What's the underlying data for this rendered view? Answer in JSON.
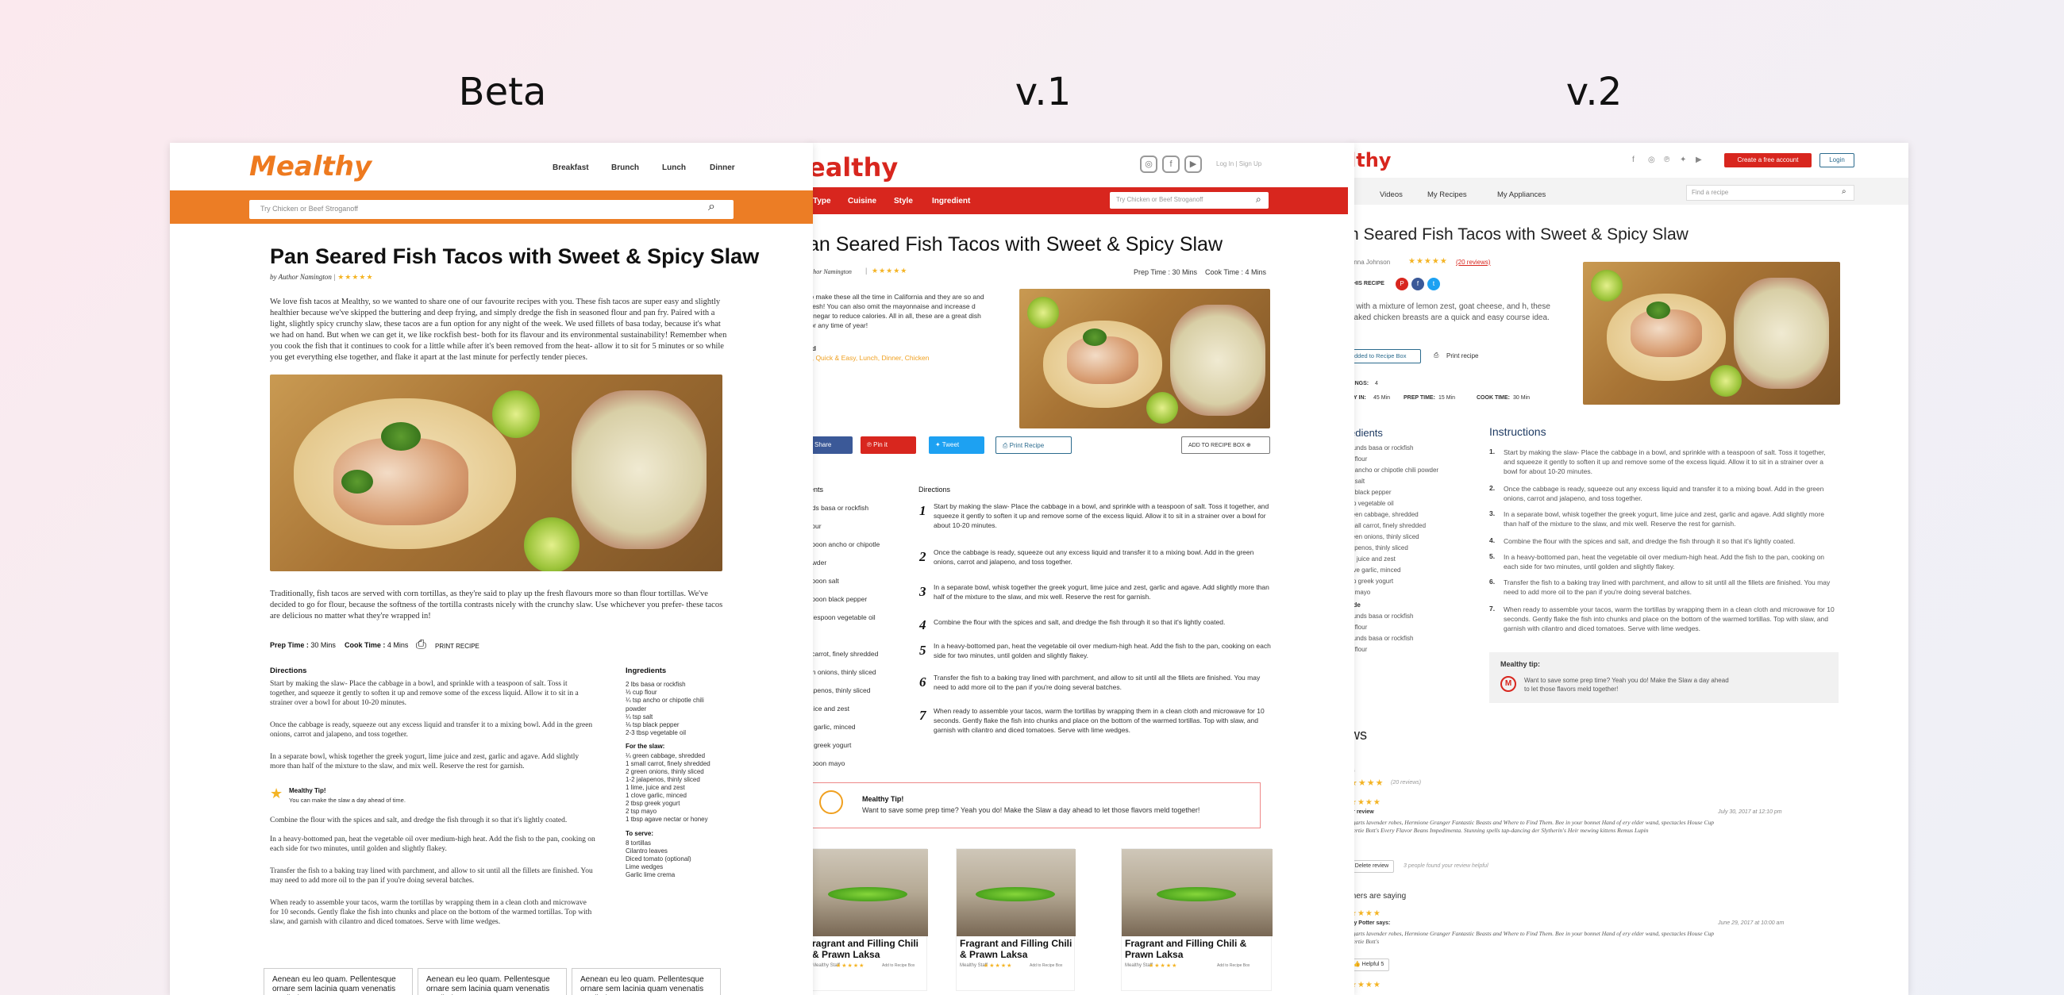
{
  "headings": {
    "beta": "Beta",
    "v1": "v.1",
    "v2": "v.2"
  },
  "recipe": {
    "title": "Pan Seared Fish Tacos with Sweet & Spicy Slaw",
    "v1_title": "an Seared Fish Tacos with Sweet & Spicy Slaw",
    "v2_title": "n Seared Fish Tacos with Sweet & Spicy Slaw"
  },
  "beta": {
    "logo": "Mealthy",
    "nav": [
      "Breakfast",
      "Brunch",
      "Lunch",
      "Dinner"
    ],
    "search_placeholder": "Try Chicken or Beef Stroganoff",
    "byline": "by Author Namington",
    "stars": "★★★★★",
    "intro": "We love fish tacos at Mealthy, so we wanted to share one of our favourite recipes with you. These fish tacos are super easy and slightly healthier because we've skipped the buttering and deep frying, and simply dredge the fish in seasoned flour and pan fry. Paired with a light, slightly spicy crunchy slaw, these tacos are a fun option for any night of the week. We used fillets of basa today, because it's what we had on hand. But when we can get it, we like rockfish best- both for its flavour and its environmental sustainability! Remember when you cook the fish that it continues to cook for a little while after it's been removed from the heat- allow it to sit for 5 minutes or so while you get everything else together, and flake it apart at the last minute for perfectly tender pieces.",
    "intro2": "Traditionally, fish tacos are served with corn tortillas, as they're said to play up the fresh flavours more so than flour tortillas. We've decided to go for flour, because the softness of the tortilla contrasts nicely with the crunchy slaw. Use whichever you prefer- these tacos are delicious no matter what they're wrapped in!",
    "prep_label": "Prep Time :",
    "prep_value": "30 Mins",
    "cook_label": "Cook Time :",
    "cook_value": "4 Mins",
    "print": "PRINT RECIPE",
    "directions_label": "Directions",
    "directions": [
      "Start by making the slaw- Place the cabbage in a bowl, and sprinkle with a teaspoon of salt. Toss it together, and squeeze it gently to soften it up and remove some of the excess liquid. Allow it to sit in a strainer over a bowl for about 10-20 minutes.",
      "Once the cabbage is ready, squeeze out any excess liquid and transfer it to a mixing bowl. Add in the green onions, carrot and jalapeno, and toss together.",
      "In a separate bowl, whisk together the greek yogurt, lime juice and zest, garlic and agave. Add slightly more than half of the mixture to the slaw, and mix well. Reserve the rest for garnish.",
      "Combine the flour with the spices and salt, and dredge the fish through it so that it's lightly coated.",
      "In a heavy-bottomed pan, heat the vegetable oil over medium-high heat. Add the fish to the pan, cooking on each side for two minutes, until golden and slightly flakey.",
      "Transfer the fish to a baking tray lined with parchment, and allow to sit until all the fillets are finished. You may need to add more oil to the pan if you're doing several batches.",
      "When ready to assemble your tacos, warm the tortillas by wrapping them in a clean cloth and microwave for 10 seconds. Gently flake the fish into chunks and place on the bottom of the warmed tortillas. Top with slaw, and garnish with cilantro and diced tomatoes. Serve with lime wedges."
    ],
    "tip_title": "Mealthy Tip!",
    "tip_text": "You can make the slaw a day ahead of time.",
    "ingredients_label": "Ingredients",
    "ingredients": [
      "2 lbs basa or rockfish",
      "⅓ cup flour",
      "¼ tsp ancho or chipotle chili powder",
      "¼ tsp salt",
      "⅛ tsp black pepper",
      "2-3 tbsp vegetable oil"
    ],
    "slaw_label": "For the slaw:",
    "slaw": [
      "¼ green cabbage, shredded",
      "1 small carrot, finely shredded",
      "2 green onions, thinly sliced",
      "1-2 jalapenos, thinly sliced",
      "1 lime, juice and zest",
      "1 clove garlic, minced",
      "2 tbsp greek yogurt",
      "2 tsp mayo",
      "1 tbsp agave nectar or honey"
    ],
    "serve_label": "To serve:",
    "serve": [
      "8 tortillas",
      "Cilantro leaves",
      "Diced tomato (optional)",
      "Lime wedges",
      "Garlic lime crema"
    ],
    "cards": [
      "Aenean eu leo quam. Pellentesque ornare sem lacinia quam venenatis vestibulum",
      "Aenean eu leo quam. Pellentesque ornare sem lacinia quam venenatis vestibulum",
      "Aenean eu leo quam. Pellentesque ornare sem lacinia quam venenatis vestibulum"
    ]
  },
  "v1": {
    "logo": "ealthy",
    "nav": [
      "Type",
      "Cuisine",
      "Style",
      "Ingredient"
    ],
    "search_placeholder": "Try Chicken or Beef Stroganoff",
    "login": "Log In | Sign Up",
    "byline": "uthor Namington",
    "stars": "★★★★★",
    "prep": "Prep Time : 30 Mins",
    "cook": "Cook Time : 4 Mins",
    "intro": "to make these all the time in California and they are so and fresh! You can also omit the mayonnaise and increase d vinegar to reduce calories. All in all, these are a great dish for any time of year!",
    "tags_label": "ed",
    "tags": "n, Quick & Easy, Lunch, Dinner, Chicken",
    "share": "Share",
    "pin": "Pin it",
    "tweet": "Tweet",
    "print": "Print Recipe",
    "add_box": "ADD TO RECIPE BOX",
    "ingredients_label": "ients",
    "ingredients": [
      "nds basa or rockfish",
      "flour",
      "spoon ancho or chipotle",
      "owder",
      "spoon salt",
      "spoon black pepper",
      "blespoon vegetable oil",
      "",
      "l carrot, finely shredded",
      "en onions, thinly sliced",
      "lapenos, thinly sliced",
      "juice and zest",
      "e garlic, minced",
      "p greek yogurt",
      "spoon mayo"
    ],
    "directions_label": "Directions",
    "tip_title": "Mealthy Tip!",
    "tip_text": "Want to save some prep time? Yeah you do! Make the Slaw a day ahead to let those flavors meld together!",
    "cards": [
      {
        "title": "ragrant and Filling Chili & Prawn Laksa",
        "by": "Mealthy Staff",
        "stars": "★★★★★",
        "detail": "Add to Recipe Box"
      },
      {
        "title": "Fragrant and Filling Chili & Prawn Laksa",
        "by": "Mealthy Staff",
        "stars": "★★★★★",
        "detail": "Add to Recipe Box"
      },
      {
        "title": "Fragrant and Filling Chili & Prawn Laksa",
        "by": "Mealthy Staff",
        "stars": "★★★★★",
        "detail": "Add to Recipe Box"
      }
    ]
  },
  "v2": {
    "logo": "lthy",
    "create_account": "Create a free account",
    "login": "Login",
    "nav": [
      "Videos",
      "My Recipes",
      "My Appliances"
    ],
    "search_placeholder": "Find a recipe",
    "author": "Anna Johnson",
    "stars": "★★★★★",
    "review_count": "(20 reviews)",
    "share_label": "THIS RECIPE",
    "intro": "d with a mixture of lemon zest, goat cheese, and h, these baked chicken breasts are a quick and easy course idea.",
    "added": "Added to Recipe Box",
    "print": "Print recipe",
    "servings_label": "VINGS:",
    "servings": "4",
    "ready_label": "DY IN:",
    "ready": "45 Min",
    "prep_label": "PREP TIME:",
    "prep": "15 Min",
    "cook_label": "COOK TIME:",
    "cook": "30 Min",
    "ingredients_label": "edients",
    "ingredients": [
      "ounds basa or rockfish",
      "p flour",
      "p ancho or chipotle chili powder",
      "p salt",
      "p black pepper",
      "sp vegetable oil",
      "reen cabbage, shredded",
      "mall carrot, finely shredded",
      "reen onions, thinly sliced",
      "lapenos, thinly sliced",
      "e, juice and zest",
      "ove garlic, minced",
      "sp greek yogurt",
      "p mayo",
      "ade",
      "ounds basa or rockfish",
      "p flour",
      "ounds basa or rockfish",
      "p flour"
    ],
    "instructions_label": "Instructions",
    "instructions": [
      "Start by making the slaw- Place the cabbage in a bowl, and sprinkle with a teaspoon of salt. Toss it together, and squeeze it gently to soften it up and remove some of the excess liquid. Allow it to sit in a strainer over a bowl for about 10-20 minutes.",
      "Once the cabbage is ready, squeeze out any excess liquid and transfer it to a mixing bowl. Add in the green onions, carrot and jalapeno, and toss together.",
      "In a separate bowl, whisk together the greek yogurt, lime juice and zest, garlic and agave. Add slightly more than half of the mixture to the slaw, and mix well. Reserve the rest for garnish.",
      "Combine the flour with the spices and salt, and dredge the fish through it so that it's lightly coated.",
      "In a heavy-bottomed pan, heat the vegetable oil over medium-high heat. Add the fish to the pan, cooking on each side for two minutes, until golden and slightly flakey.",
      "Transfer the fish to a baking tray lined with parchment, and allow to sit until all the fillets are finished. You may need to add more oil to the pan if you're doing several batches.",
      "When ready to assemble your tacos, warm the tortillas by wrapping them in a clean cloth and microwave for 10 seconds. Gently flake the fish into chunks and place on the bottom of the warmed tortillas. Top with slaw, and garnish with cilantro and diced tomatoes. Serve with lime wedges."
    ],
    "tip_title": "Mealthy tip:",
    "tip_text": "Want to save some prep time? Yeah you do! Make the Slaw a day ahead to let those flavors meld together!",
    "reviews_label": "ws",
    "rating_label": "rs",
    "rating_count": "(20 reviews)",
    "your_review": "ur review",
    "your_review_date": "July 30, 2017 at 12:10 pm",
    "your_review_text": "ggarts lavender robes, Hermione Granger Fantastic Beasts and Where to Find Them. Bee in your bonnet Hand of ery elder wand, spectacles House Cup Bertie Bott's Every Flavor Beans Impedimenta. Stunning spells tap-dancing der Slytherin's Heir mewing kittens Remus Lupin",
    "delete": "Delete review",
    "helpful_note": "3 people found your review helpful",
    "others_label": "thers are saying",
    "other_name": "rry Potter says:",
    "other_date": "June 29, 2017 at 10:00 am",
    "other_text": "ggarts lavender robes, Hermione Granger Fantastic Beasts and Where to Find Them. Bee in your bonnet Hand of ery elder wand, spectacles House Cup Bertie Bott's",
    "helpful_btn": "Helpful",
    "helpful_count": "5"
  }
}
